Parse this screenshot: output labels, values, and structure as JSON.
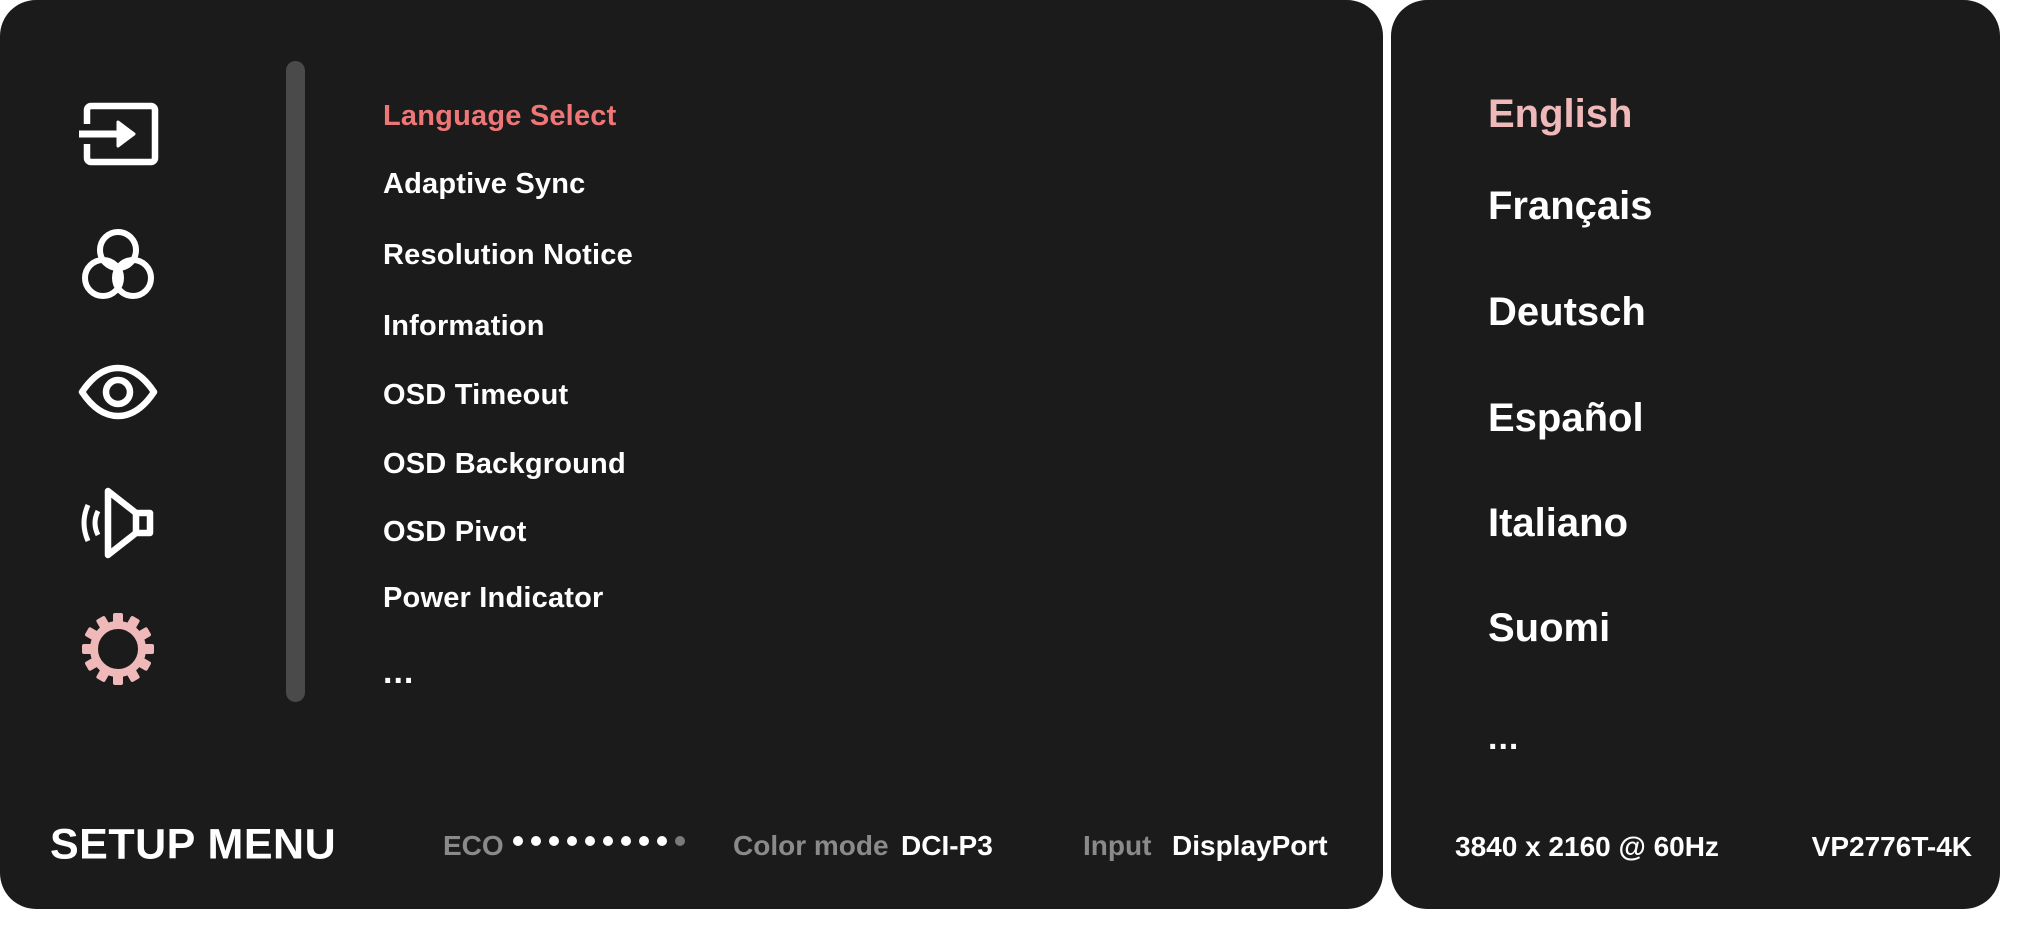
{
  "osd": {
    "title": "SETUP MENU",
    "nav_icons": [
      {
        "name": "input-source-icon",
        "label": "Input Select",
        "active": false
      },
      {
        "name": "color-adjust-icon",
        "label": "Color Adjust",
        "active": false
      },
      {
        "name": "view-mode-icon",
        "label": "Viewmode",
        "active": false
      },
      {
        "name": "audio-icon",
        "label": "Audio Adjust",
        "active": false
      },
      {
        "name": "setup-gear-icon",
        "label": "Setup Menu",
        "active": true
      }
    ],
    "menu_items": [
      {
        "label": "Language Select",
        "selected": true
      },
      {
        "label": "Adaptive Sync",
        "selected": false
      },
      {
        "label": "Resolution Notice",
        "selected": false
      },
      {
        "label": "Information",
        "selected": false
      },
      {
        "label": "OSD Timeout",
        "selected": false
      },
      {
        "label": "OSD Background",
        "selected": false
      },
      {
        "label": "OSD Pivot",
        "selected": false
      },
      {
        "label": "Power Indicator",
        "selected": false
      },
      {
        "label": "...",
        "selected": false
      }
    ],
    "languages": [
      {
        "label": "English",
        "selected": true
      },
      {
        "label": "Français",
        "selected": false
      },
      {
        "label": "Deutsch",
        "selected": false
      },
      {
        "label": "Español",
        "selected": false
      },
      {
        "label": "Italiano",
        "selected": false
      },
      {
        "label": "Suomi",
        "selected": false
      },
      {
        "label": "...",
        "selected": false
      }
    ],
    "status": {
      "eco_label": "ECO",
      "eco_level": 9,
      "eco_max": 10,
      "color_mode_label": "Color mode",
      "color_mode_value": "DCI-P3",
      "input_label": "Input",
      "input_value": "DisplayPort"
    },
    "signal": {
      "resolution": "3840 x 2160 @ 60Hz",
      "model": "VP2776T-4K"
    },
    "colors": {
      "panel_bg": "#1b1b1b",
      "menu_highlight": "#ef7676",
      "language_highlight": "#f0b9b9",
      "active_icon": "#f0b9b9",
      "label_gray": "#8a8a8a",
      "text": "#ffffff"
    }
  }
}
